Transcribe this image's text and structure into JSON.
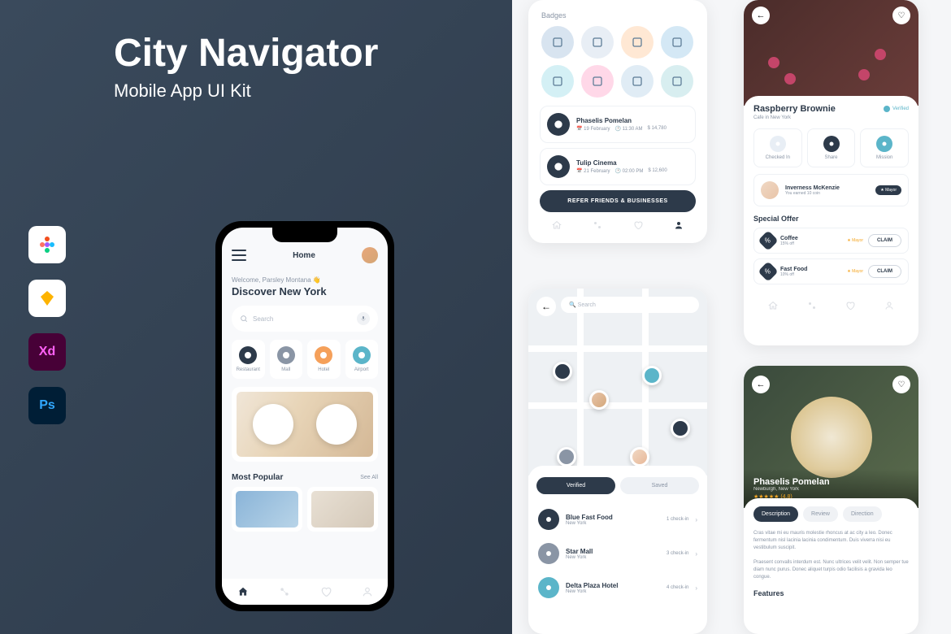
{
  "hero": {
    "title": "City Navigator",
    "subtitle": "Mobile App UI Kit"
  },
  "home": {
    "title": "Home",
    "welcome": "Welcome, Parsley Montana 👋",
    "discover": "Discover New York",
    "search_placeholder": "Search",
    "categories": [
      {
        "label": "Restaurant",
        "color": "#2d3a4a"
      },
      {
        "label": "Mall",
        "color": "#8a95a5"
      },
      {
        "label": "Hotel",
        "color": "#f5a05a"
      },
      {
        "label": "Airport",
        "color": "#5bb5c9"
      }
    ],
    "section": "Most Popular",
    "see_all": "See All"
  },
  "badges": {
    "title": "Badges",
    "colors": [
      "#d8e4f0",
      "#e8eef5",
      "#ffe8d4",
      "#d4e8f5",
      "#d4f0f5",
      "#ffd8e8",
      "#e0ecf5",
      "#d8eef0"
    ],
    "items": [
      {
        "name": "Phaselis Pomelan",
        "date": "19 February",
        "time": "11:30 AM",
        "amount": "14,780"
      },
      {
        "name": "Tulip Cinema",
        "date": "21 February",
        "time": "02:00 PM",
        "amount": "12,600"
      }
    ],
    "refer": "REFER FRIENDS & BUSINESSES"
  },
  "map": {
    "search_placeholder": "Search",
    "tabs": {
      "verified": "Verified",
      "saved": "Saved"
    },
    "places": [
      {
        "name": "Blue Fast Food",
        "city": "New York",
        "checkins": "1 check-in",
        "color": "#2d3a4a"
      },
      {
        "name": "Star Mall",
        "city": "New York",
        "checkins": "3 check-in",
        "color": "#8a95a5"
      },
      {
        "name": "Delta Plaza Hotel",
        "city": "New York",
        "checkins": "4 check-in",
        "color": "#5bb5c9"
      }
    ]
  },
  "detail": {
    "title": "Raspberry Brownie",
    "subtitle": "Cafe in New York",
    "verified": "Verified",
    "actions": [
      {
        "label": "Checked In",
        "color": "#e8eef5"
      },
      {
        "label": "Share",
        "color": "#2d3a4a"
      },
      {
        "label": "Mission",
        "color": "#5bb5c9"
      }
    ],
    "user": {
      "name": "Inverness McKenzie",
      "sub": "You earned 10 coin",
      "badge": "★ Mayor"
    },
    "offer_title": "Special Offer",
    "offers": [
      {
        "name": "Coffee",
        "disc": "15% off",
        "mayor": "★ Mayor",
        "btn": "CLAIM"
      },
      {
        "name": "Fast Food",
        "disc": "10% off",
        "mayor": "★ Mayor",
        "btn": "CLAIM"
      }
    ]
  },
  "detail2": {
    "title": "Phaselis Pomelan",
    "subtitle": "Newburgh, New York",
    "rating": "★★★★★ (4.8)",
    "tabs": [
      "Description",
      "Review",
      "Direction"
    ],
    "desc": "Cras vitae mi eu mauris molestie rhoncus at ac city a leo. Donec fermentum nisl lacinia lacinia condimentum. Duis viverra nisi eu vestibulum suscipit.\n\nPraesent convalls interdum est. Nunc ultrices velit velit. Non semper tue diam nunc purus. Donec aliquet turpis odio facilisis a gravida leo congue.",
    "features": "Features"
  }
}
